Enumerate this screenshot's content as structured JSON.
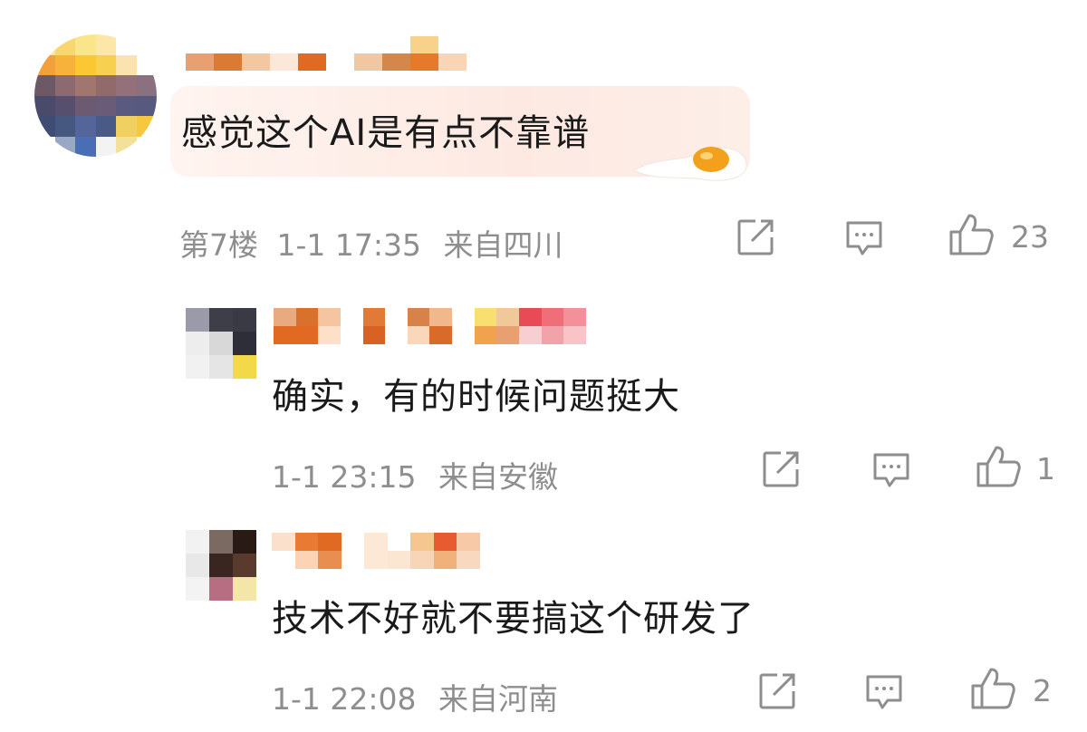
{
  "comments": [
    {
      "text": "感觉这个AI是有点不靠谱",
      "floor": "第7楼",
      "time": "1-1 17:35",
      "location": "来自四川",
      "likes": "23"
    },
    {
      "text": "确实，有的时候问题挺大",
      "time": "1-1 23:15",
      "location": "来自安徽",
      "likes": "1"
    },
    {
      "text": "技术不好就不要搞这个研发了",
      "time": "1-1 22:08",
      "location": "来自河南",
      "likes": "2"
    }
  ],
  "icons": {
    "share": "share-icon",
    "reply": "reply-comment-icon",
    "like": "thumbs-up-icon",
    "decoration": "fried-egg-icon"
  },
  "colors": {
    "text": "#1a1a1a",
    "meta": "#8e8e8e",
    "bubble": "#fde9e2",
    "egg_yolk": "#f5a623"
  }
}
